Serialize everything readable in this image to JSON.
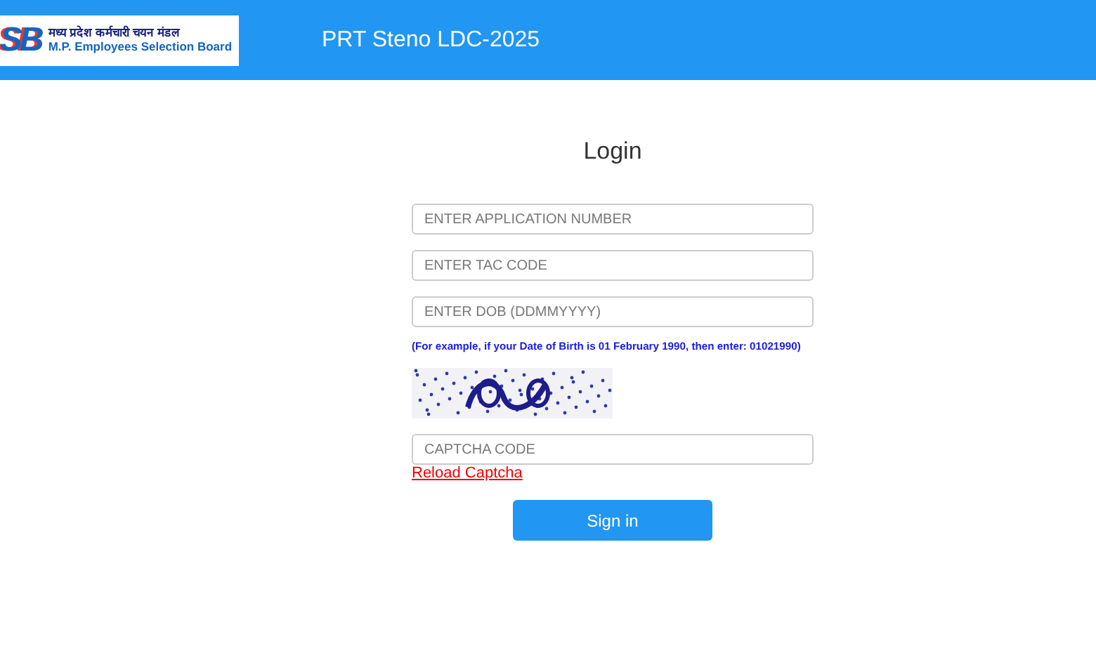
{
  "header": {
    "logo": {
      "mark": "SB",
      "line_1": "मध्य प्रदेश कर्मचारी चयन मंडल",
      "line_2": "M.P. Employees Selection Board"
    },
    "title": "PRT Steno LDC-2025"
  },
  "form": {
    "heading": "Login",
    "fields": [
      {
        "placeholder": "ENTER APPLICATION NUMBER"
      },
      {
        "placeholder": "ENTER TAC CODE"
      },
      {
        "placeholder": "ENTER DOB (DDMMYYYY)"
      }
    ],
    "hint": "(For example, if your Date of Birth is 01 February 1990, then enter: 01021990)",
    "captcha_field": {
      "placeholder": "CAPTCHA CODE"
    },
    "reload_link": "Reload Captcha",
    "submit": "Sign in"
  }
}
